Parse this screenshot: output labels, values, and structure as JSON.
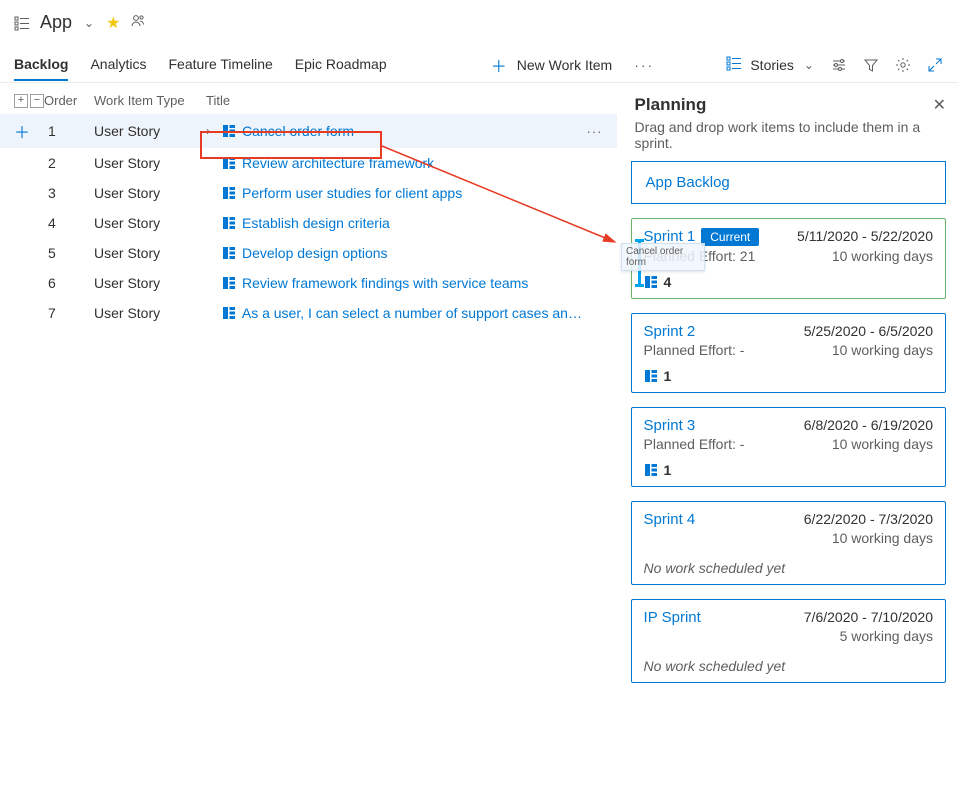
{
  "header": {
    "app_name": "App"
  },
  "tabs": [
    "Backlog",
    "Analytics",
    "Feature Timeline",
    "Epic Roadmap"
  ],
  "toolbar": {
    "new_work_item": "New Work Item",
    "view_label": "Stories"
  },
  "grid": {
    "headers": {
      "order": "Order",
      "type": "Work Item Type",
      "title": "Title"
    },
    "items": [
      {
        "order": "1",
        "type": "User Story",
        "title": "Cancel order form",
        "selected": true,
        "expandable": true
      },
      {
        "order": "2",
        "type": "User Story",
        "title": "Review architecture framework"
      },
      {
        "order": "3",
        "type": "User Story",
        "title": "Perform user studies for client apps"
      },
      {
        "order": "4",
        "type": "User Story",
        "title": "Establish design criteria"
      },
      {
        "order": "5",
        "type": "User Story",
        "title": "Develop design options"
      },
      {
        "order": "6",
        "type": "User Story",
        "title": "Review framework findings with service teams"
      },
      {
        "order": "7",
        "type": "User Story",
        "title": "As a user, I can select a number of support cases and ..."
      }
    ]
  },
  "planning": {
    "title": "Planning",
    "subtitle": "Drag and drop work items to include them in a sprint.",
    "app_backlog_label": "App Backlog",
    "sprints": [
      {
        "name": "Sprint 1",
        "dates": "5/11/2020 - 5/22/2020",
        "days": "10 working days",
        "effort": "Planned Effort: 21",
        "count": "4",
        "current": true,
        "current_label": "Current"
      },
      {
        "name": "Sprint 2",
        "dates": "5/25/2020 - 6/5/2020",
        "days": "10 working days",
        "effort": "Planned Effort: -",
        "count": "1"
      },
      {
        "name": "Sprint 3",
        "dates": "6/8/2020 - 6/19/2020",
        "days": "10 working days",
        "effort": "Planned Effort: -",
        "count": "1"
      },
      {
        "name": "Sprint 4",
        "dates": "6/22/2020 - 7/3/2020",
        "days": "10 working days",
        "no_work": "No work scheduled yet"
      },
      {
        "name": "IP Sprint",
        "dates": "7/6/2020 - 7/10/2020",
        "days": "5 working days",
        "no_work": "No work scheduled yet"
      }
    ]
  },
  "drag_ghost": {
    "text": "Cancel order form"
  }
}
